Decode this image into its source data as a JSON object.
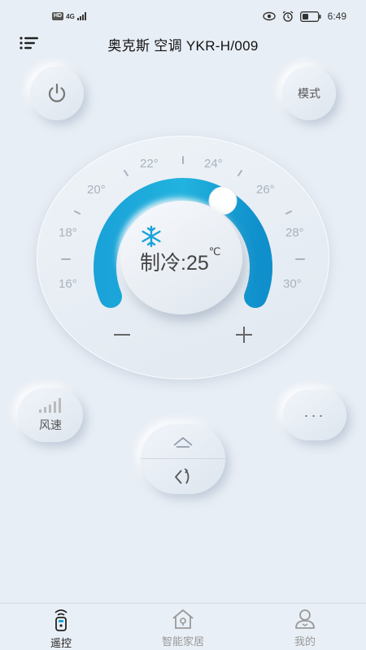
{
  "status_bar": {
    "network_badge": "HD",
    "network_type": "4G",
    "time": "6:49",
    "icons": [
      "eye-icon",
      "alarm-icon",
      "battery-icon"
    ]
  },
  "header": {
    "title": "奥克斯 空调 YKR-H/009",
    "menu_icon": "menu-icon"
  },
  "controls": {
    "power_icon": "power-icon",
    "mode_label": "模式",
    "wind_label": "风速",
    "more_label": "···"
  },
  "dial": {
    "mode_text": "制冷:25",
    "unit": "℃",
    "current_temperature": 25,
    "min_temperature": 16,
    "max_temperature": 30,
    "mode_icon": "snowflake-icon",
    "accent_color": "#1aa3d8",
    "scale_labels": [
      "16°",
      "18°",
      "20°",
      "22°",
      "24°",
      "26°",
      "28°",
      "30°"
    ]
  },
  "tabbar": {
    "tabs": [
      {
        "label": "遥控",
        "icon": "remote-icon",
        "active": true
      },
      {
        "label": "智能家居",
        "icon": "home-icon",
        "active": false
      },
      {
        "label": "我的",
        "icon": "user-icon",
        "active": false
      }
    ]
  }
}
